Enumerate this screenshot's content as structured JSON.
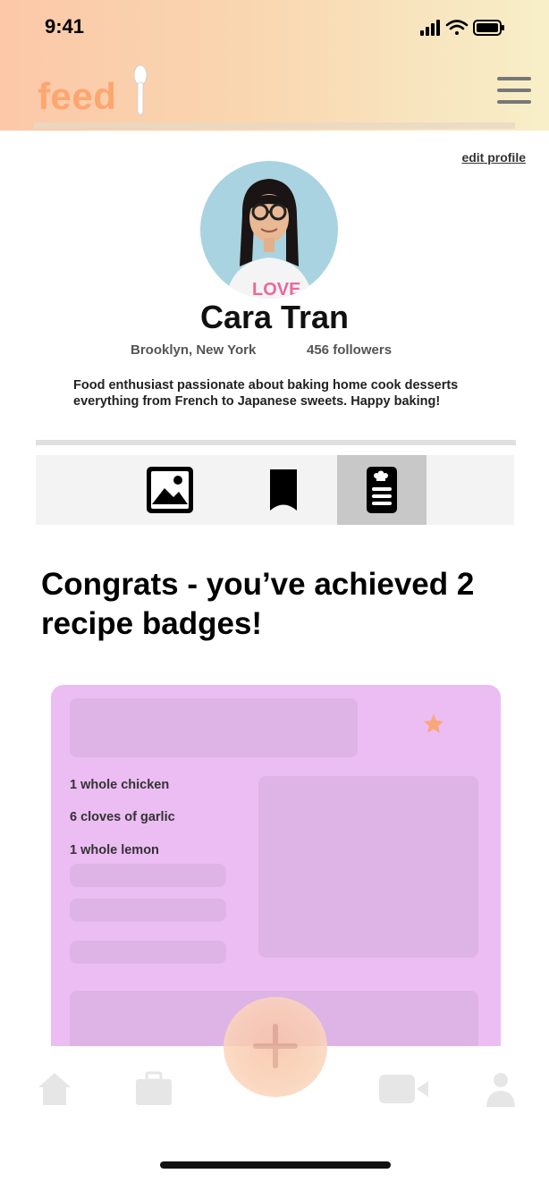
{
  "status_bar": {
    "time": "9:41"
  },
  "header": {
    "logo": "feed"
  },
  "profile": {
    "edit_label": "edit profile",
    "name": "Cara Tran",
    "location": "Brooklyn, New York",
    "followers": "456 followers",
    "bio": "Food enthusiast passionate about baking home cook desserts everything from French to Japanese sweets. Happy baking!"
  },
  "tabs": [
    {
      "icon": "image-icon",
      "active": false
    },
    {
      "icon": "bookmark-icon",
      "active": false
    },
    {
      "icon": "recipe-card-icon",
      "active": true
    }
  ],
  "main": {
    "headline": "Congrats - you’ve achieved 2 recipe badges!"
  },
  "recipe_card": {
    "ingredients": [
      "1 whole chicken",
      "6 cloves of garlic",
      "1 whole lemon"
    ],
    "star_icon": "star-icon"
  },
  "bottom_nav": [
    "home-icon",
    "briefcase-icon",
    "add-icon",
    "video-icon",
    "person-icon"
  ],
  "colors": {
    "accent": "#fda66f",
    "card_bg": "#ecbdf3",
    "star": "#f9a77a"
  }
}
